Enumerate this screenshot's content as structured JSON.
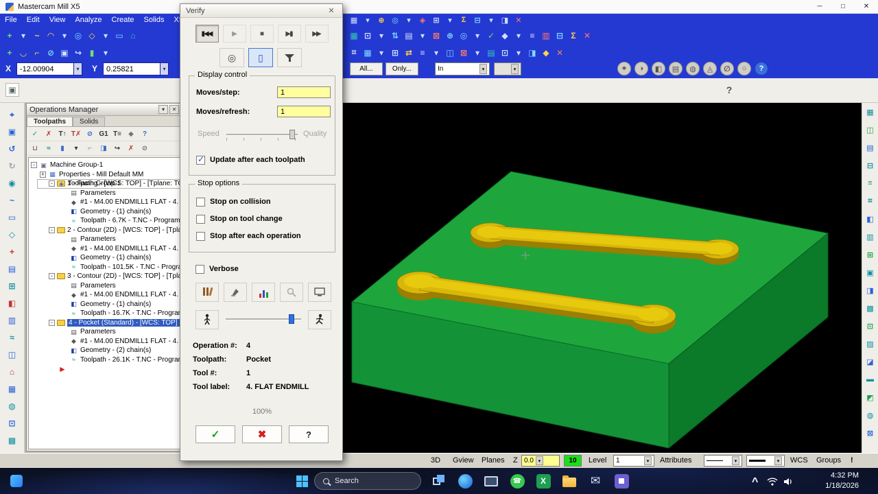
{
  "titlebar": {
    "title": "Mastercam Mill X5",
    "minimize": "─",
    "maximize": "□",
    "close": "✕"
  },
  "menubar": {
    "items": [
      "File",
      "Edit",
      "View",
      "Analyze",
      "Create",
      "Solids",
      "Xform"
    ]
  },
  "toolbars": {
    "menu_right": [
      {
        "g": "▦",
        "color": "#cfe0ff"
      },
      {
        "g": "▾",
        "color": "#cfe0ff"
      },
      {
        "g": "⊕",
        "color": "#ffd24a"
      },
      {
        "g": "◎",
        "color": "#7fd8ff"
      },
      {
        "g": "▾",
        "color": "#cfe0ff"
      },
      {
        "g": "◈",
        "color": "#ff7a6a"
      },
      {
        "g": "⊞",
        "color": "#cfe0ff"
      },
      {
        "g": "▾",
        "color": "#cfe0ff"
      },
      {
        "g": "Σ",
        "color": "#ffd24a"
      },
      {
        "g": "⊟",
        "color": "#7fd8ff"
      },
      {
        "g": "▾",
        "color": "#cfe0ff"
      },
      {
        "g": "◨",
        "color": "#cfe0ff"
      },
      {
        "g": "✕",
        "color": "#ff7a6a"
      }
    ],
    "row1_left": [
      {
        "g": "+",
        "color": "#6ee06e"
      },
      {
        "g": "▾",
        "color": "#cfe0ff"
      },
      {
        "g": "~",
        "color": "#ffd24a"
      },
      {
        "g": "◠",
        "color": "#ffd24a"
      },
      {
        "g": "▾",
        "color": "#cfe0ff"
      },
      {
        "g": "◎",
        "color": "#7fd8ff"
      },
      {
        "g": "◇",
        "color": "#ffd24a"
      },
      {
        "g": "▾",
        "color": "#cfe0ff"
      },
      {
        "g": "▭",
        "color": "#7fd8ff"
      },
      {
        "g": "⌂",
        "color": "#35c8b4"
      }
    ],
    "row1_right": [
      {
        "g": "▦",
        "color": "#35c8b4"
      },
      {
        "g": "⊡",
        "color": "#cfe0ff"
      },
      {
        "g": "▾",
        "color": "#cfe0ff"
      },
      {
        "g": "⇅",
        "color": "#7fd8ff"
      },
      {
        "g": "▤",
        "color": "#cfe0ff"
      },
      {
        "g": "▾",
        "color": "#cfe0ff"
      },
      {
        "g": "⊠",
        "color": "#ff7a6a"
      },
      {
        "g": "⊕",
        "color": "#7fd8ff"
      },
      {
        "g": "◎",
        "color": "#7fd8ff"
      },
      {
        "g": "▾",
        "color": "#cfe0ff"
      },
      {
        "g": "✓",
        "color": "#6ee06e"
      },
      {
        "g": "◆",
        "color": "#cfe0ff"
      },
      {
        "g": "▾",
        "color": "#cfe0ff"
      },
      {
        "g": "≡",
        "color": "#cfe0ff"
      },
      {
        "g": "▥",
        "color": "#ff7a6a"
      },
      {
        "g": "⊟",
        "color": "#7fd8ff"
      },
      {
        "g": "Σ",
        "color": "#ffd24a"
      },
      {
        "g": "✕",
        "color": "#ff7a6a"
      }
    ],
    "row2_left": [
      {
        "g": "+",
        "color": "#6ee06e"
      },
      {
        "g": "◡",
        "color": "#ffd24a"
      },
      {
        "g": "⌐",
        "color": "#ffd24a"
      },
      {
        "g": "⊘",
        "color": "#7fd8ff"
      },
      {
        "g": "▣",
        "color": "#cfe0ff"
      },
      {
        "g": "↪",
        "color": "#cfe0ff"
      },
      {
        "g": "▮",
        "color": "#6ee06e"
      },
      {
        "g": "▾",
        "color": "#cfe0ff"
      }
    ],
    "row2_right": [
      {
        "g": "⌗",
        "color": "#cfe0ff"
      },
      {
        "g": "▦",
        "color": "#7fd8ff"
      },
      {
        "g": "▾",
        "color": "#cfe0ff"
      },
      {
        "g": "⊞",
        "color": "#cfe0ff"
      },
      {
        "g": "⇄",
        "color": "#ffd24a"
      },
      {
        "g": "≡",
        "color": "#cfe0ff"
      },
      {
        "g": "▾",
        "color": "#cfe0ff"
      },
      {
        "g": "◫",
        "color": "#7fd8ff"
      },
      {
        "g": "⊠",
        "color": "#ff7a6a"
      },
      {
        "g": "▾",
        "color": "#cfe0ff"
      },
      {
        "g": "▤",
        "color": "#35c8b4"
      },
      {
        "g": "⊡",
        "color": "#cfe0ff"
      },
      {
        "g": "▾",
        "color": "#cfe0ff"
      },
      {
        "g": "◨",
        "color": "#7fd8ff"
      },
      {
        "g": "◆",
        "color": "#ffd24a"
      },
      {
        "g": "✕",
        "color": "#ff7a6a"
      }
    ],
    "ribbon_icons": [
      {
        "g": "⌖"
      },
      {
        "g": "◑"
      },
      {
        "g": "◧"
      },
      {
        "g": "▤"
      },
      {
        "g": "◍"
      },
      {
        "g": "◬"
      },
      {
        "g": "∅"
      },
      {
        "g": "○"
      },
      {
        "g": "?",
        "cls": "help"
      }
    ]
  },
  "ribbon": {
    "x_label": "X",
    "x_value": "-12.00904",
    "y_label": "Y",
    "y_value": "0.25821",
    "all_button": "All...",
    "only_button": "Only...",
    "in_combo": "In"
  },
  "misc": {
    "left_panel_icon": "▣",
    "help_icon": "?"
  },
  "left_rail": [
    {
      "g": "⌖",
      "color": "#2a62d8"
    },
    {
      "g": "▣",
      "color": "#2a62d8"
    },
    {
      "g": "↺",
      "color": "#2a62d8"
    },
    {
      "g": "↻",
      "color": "#96a2b8"
    },
    {
      "g": "◉",
      "color": "#0e8fa0"
    },
    {
      "g": "~",
      "color": "#2a62d8"
    },
    {
      "g": "▭",
      "color": "#2a62d8"
    },
    {
      "g": "◇",
      "color": "#0e8fa0"
    },
    {
      "g": "+",
      "color": "#c83232"
    },
    {
      "g": "▤",
      "color": "#2a62d8"
    },
    {
      "g": "⊞",
      "color": "#0e8fa0"
    },
    {
      "g": "◧",
      "color": "#c83232"
    },
    {
      "g": "▥",
      "color": "#2a62d8"
    },
    {
      "g": "≈",
      "color": "#0e8fa0"
    },
    {
      "g": "◫",
      "color": "#2a62d8"
    },
    {
      "g": "⌂",
      "color": "#c83232"
    },
    {
      "g": "▦",
      "color": "#2a62d8"
    },
    {
      "g": "◍",
      "color": "#0e8fa0"
    },
    {
      "g": "⊡",
      "color": "#2a62d8"
    },
    {
      "g": "▩",
      "color": "#0e8fa0"
    }
  ],
  "right_rail": [
    {
      "g": "▦",
      "color": "#0e8fa0"
    },
    {
      "g": "◫",
      "color": "#1f9e4a"
    },
    {
      "g": "▤",
      "color": "#2a62d8"
    },
    {
      "g": "⊟",
      "color": "#0e8fa0"
    },
    {
      "g": "≡",
      "color": "#1f9e4a"
    },
    {
      "g": "⌗",
      "color": "#0e8fa0"
    },
    {
      "g": "◧",
      "color": "#2a62d8"
    },
    {
      "g": "▥",
      "color": "#0e8fa0"
    },
    {
      "g": "⊞",
      "color": "#1f9e4a"
    },
    {
      "g": "▣",
      "color": "#0e8fa0"
    },
    {
      "g": "◨",
      "color": "#2a62d8"
    },
    {
      "g": "▩",
      "color": "#0e8fa0"
    },
    {
      "g": "⊡",
      "color": "#1f9e4a"
    },
    {
      "g": "▨",
      "color": "#0e8fa0"
    },
    {
      "g": "◪",
      "color": "#2a62d8"
    },
    {
      "g": "▬",
      "color": "#0e8fa0"
    },
    {
      "g": "◩",
      "color": "#1f9e4a"
    },
    {
      "g": "◍",
      "color": "#0e8fa0"
    },
    {
      "g": "⊠",
      "color": "#2a62d8"
    }
  ],
  "opman": {
    "title": "Operations Manager",
    "menu_glyph": "▾",
    "close_glyph": "✕",
    "tabs": [
      {
        "label": "Toolpaths",
        "cls": "active"
      },
      {
        "label": "Solids"
      }
    ],
    "toolbar1": [
      {
        "g": "✓",
        "color": "#0a9a8a"
      },
      {
        "g": "✗",
        "color": "#c03030"
      },
      {
        "g": "T↑",
        "color": "#333333"
      },
      {
        "g": "T✗",
        "color": "#c03030"
      },
      {
        "g": "⊘",
        "color": "#3a68c8"
      },
      {
        "g": "G1",
        "color": "#333333"
      },
      {
        "g": "T≡",
        "color": "#333333"
      },
      {
        "g": "◆",
        "color": "#777777"
      },
      {
        "g": "?",
        "color": "#3a68c8"
      }
    ],
    "toolbar2": [
      {
        "g": "⊔",
        "color": "#777777"
      },
      {
        "g": "≈",
        "color": "#0a9a8a"
      },
      {
        "g": "▮",
        "color": "#3a68c8"
      },
      {
        "g": "▾",
        "color": "#333333"
      },
      {
        "g": "⌐",
        "color": "#777777"
      },
      {
        "g": "◨",
        "color": "#3a68c8"
      },
      {
        "g": "↪",
        "color": "#333333"
      },
      {
        "g": "✗",
        "color": "#c03030"
      },
      {
        "g": "⊘",
        "color": "#777777"
      }
    ],
    "tree": [
      {
        "exp": "-",
        "icon": "▣",
        "label": "Machine Group-1",
        "cls": "lvl0 hasx mach"
      },
      {
        "exp": "+",
        "icon": "▦",
        "label": "Properties - Mill Default MM",
        "cls": "lvl1 hasx props"
      },
      {
        "exp": "-",
        "icon": "◈",
        "label": "Toolpath Group-1",
        "cls": "lvl1 hasx grp"
      },
      {
        "exp": "-",
        "label": "1 - Facing - [WCS: TOP] - [Tplane: TO",
        "cls": "lvl2 hasx fold"
      },
      {
        "icon": "▤",
        "label": "Parameters",
        "cls": "lvl3 parm"
      },
      {
        "icon": "◆",
        "label": "#1 - M4.00 ENDMILL1 FLAT - 4.",
        "cls": "lvl3 tool"
      },
      {
        "icon": "◧",
        "label": "Geometry - (1) chain(s)",
        "cls": "lvl3 geom"
      },
      {
        "icon": "≈",
        "label": "Toolpath - 6.7K - T.NC - Program",
        "cls": "lvl3 tpath"
      },
      {
        "exp": "-",
        "label": "2 - Contour (2D) - [WCS: TOP] - [Tpla",
        "cls": "lvl2 hasx fold"
      },
      {
        "icon": "▤",
        "label": "Parameters",
        "cls": "lvl3 parm"
      },
      {
        "icon": "◆",
        "label": "#1 - M4.00 ENDMILL1 FLAT - 4.",
        "cls": "lvl3 tool"
      },
      {
        "icon": "◧",
        "label": "Geometry - (1) chain(s)",
        "cls": "lvl3 geom"
      },
      {
        "icon": "≈",
        "label": "Toolpath - 101.5K - T.NC - Progra",
        "cls": "lvl3 tpath"
      },
      {
        "exp": "-",
        "label": "3 - Contour (2D) - [WCS: TOP] - [Tpla",
        "cls": "lvl2 hasx fold"
      },
      {
        "icon": "▤",
        "label": "Parameters",
        "cls": "lvl3 parm"
      },
      {
        "icon": "◆",
        "label": "#1 - M4.00 ENDMILL1 FLAT - 4.",
        "cls": "lvl3 tool"
      },
      {
        "icon": "◧",
        "label": "Geometry - (1) chain(s)",
        "cls": "lvl3 geom"
      },
      {
        "icon": "≈",
        "label": "Toolpath - 16.7K - T.NC - Program",
        "cls": "lvl3 tpath"
      },
      {
        "exp": "-",
        "label": "4 - Pocket (Standard) - [WCS: TOP] -",
        "cls": "lvl2 hasx fold sel"
      },
      {
        "icon": "▤",
        "label": "Parameters",
        "cls": "lvl3 parm"
      },
      {
        "icon": "◆",
        "label": "#1 - M4.00 ENDMILL1 FLAT - 4.",
        "cls": "lvl3 tool"
      },
      {
        "icon": "◧",
        "label": "Geometry - (2) chain(s)",
        "cls": "lvl3 geom"
      },
      {
        "icon": "≈",
        "label": "Toolpath - 26.1K - T.NC - Program",
        "cls": "lvl3 tpath"
      },
      {
        "icon": "►",
        "label": "",
        "cls": "lvl2 insert"
      }
    ]
  },
  "verify": {
    "title": "Verify",
    "close_glyph": "✕",
    "playback": [
      {
        "g": "▮◀◀",
        "cls": "pressed pc1"
      },
      {
        "g": "▶",
        "cls": "pc2"
      },
      {
        "g": "■",
        "cls": "pc3"
      },
      {
        "g": "▶▮",
        "cls": "pc4"
      },
      {
        "g": "▶▶",
        "cls": "pc4"
      }
    ],
    "mode_icons": [
      "◎",
      "▯"
    ],
    "display_group": "Display control",
    "moves_step_label": "Moves/step:",
    "moves_step_value": "1",
    "moves_refresh_label": "Moves/refresh:",
    "moves_refresh_value": "1",
    "speed_label": "Speed",
    "quality_label": "Quality",
    "update_label": "Update after each toolpath",
    "update_checked": true,
    "stop_group": "Stop options",
    "stop_options": [
      {
        "label": "Stop on collision"
      },
      {
        "label": "Stop on tool change"
      },
      {
        "label": "Stop after each operation"
      }
    ],
    "verbose_label": "Verbose",
    "info": {
      "operation_label": "Operation #:",
      "operation_value": "4",
      "toolpath_label": "Toolpath:",
      "toolpath_value": "Pocket",
      "tool_label": "Tool #:",
      "tool_value": "1",
      "label_label": "Tool label:",
      "label_value": "4. FLAT ENDMILL"
    },
    "progress": "100%",
    "ok_glyph": "✓",
    "cancel_glyph": "✖",
    "help_glyph": "?"
  },
  "statusbar": {
    "view3d": "3D",
    "gview": "Gview",
    "planes": "Planes",
    "z_label": "Z",
    "z_value": "0.0",
    "grid_value": "10",
    "level_label": "Level",
    "level_value": "1",
    "attributes": "Attributes",
    "wcs": "WCS",
    "groups": "Groups",
    "alert": "!"
  },
  "taskbar": {
    "search_placeholder": "Search",
    "time": "4:32 PM",
    "date": "1/18/2026"
  }
}
